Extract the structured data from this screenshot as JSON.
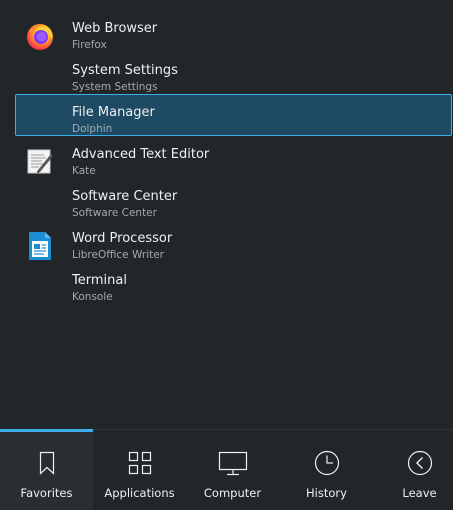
{
  "favorites": [
    {
      "name": "Web Browser",
      "subtitle": "Firefox",
      "icon": "firefox-icon",
      "selected": false
    },
    {
      "name": "System Settings",
      "subtitle": "System Settings",
      "icon": "none",
      "selected": false
    },
    {
      "name": "File Manager",
      "subtitle": "Dolphin",
      "icon": "none",
      "selected": true
    },
    {
      "name": "Advanced Text Editor",
      "subtitle": "Kate",
      "icon": "kate-icon",
      "selected": false
    },
    {
      "name": "Software Center",
      "subtitle": "Software Center",
      "icon": "none",
      "selected": false
    },
    {
      "name": "Word Processor",
      "subtitle": "LibreOffice Writer",
      "icon": "libreoffice-writer-icon",
      "selected": false
    },
    {
      "name": "Terminal",
      "subtitle": "Konsole",
      "icon": "none",
      "selected": false
    }
  ],
  "tabs": [
    {
      "label": "Favorites",
      "icon": "bookmark-icon",
      "active": true
    },
    {
      "label": "Applications",
      "icon": "grid-icon",
      "active": false
    },
    {
      "label": "Computer",
      "icon": "monitor-icon",
      "active": false
    },
    {
      "label": "History",
      "icon": "clock-icon",
      "active": false
    },
    {
      "label": "Leave",
      "icon": "back-arrow-icon",
      "active": false
    }
  ],
  "colors": {
    "background": "#232629",
    "selection_fill": "#1e4a63",
    "selection_border": "#3daee9",
    "accent": "#3daee9",
    "text": "#eff0f1",
    "subtext": "#a1a9b1"
  }
}
